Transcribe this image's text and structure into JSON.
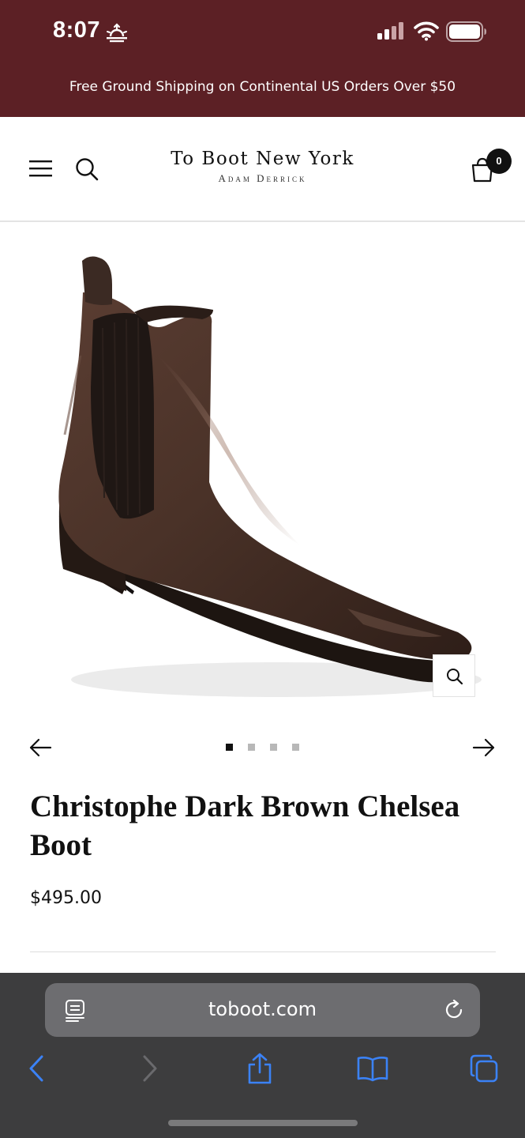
{
  "status_bar": {
    "time": "8:07",
    "icons": [
      "sunrise-icon",
      "cellular-signal-icon",
      "wifi-icon",
      "battery-icon"
    ]
  },
  "promo": {
    "text": "Free Ground Shipping on Continental US Orders Over $50"
  },
  "header": {
    "logo_main": "To Boot New York",
    "logo_sub": "Adam Derrick",
    "cart_count": "0",
    "icons": [
      "hamburger-menu-icon",
      "search-icon",
      "shopping-bag-icon"
    ]
  },
  "product": {
    "title": "Christophe Dark Brown Chelsea Boot",
    "price": "$495.00",
    "image_count": 4,
    "active_image_index": 0
  },
  "browser": {
    "url": "toboot.com",
    "icons": [
      "reader-icon",
      "reload-icon",
      "back-icon",
      "forward-icon",
      "share-icon",
      "bookmarks-icon",
      "tabs-icon"
    ]
  },
  "colors": {
    "brand_maroon": "#5c2025",
    "browser_bar": "#3d3d3e",
    "browser_accent": "#3b82f6",
    "boot_brown": "#4a3228"
  }
}
